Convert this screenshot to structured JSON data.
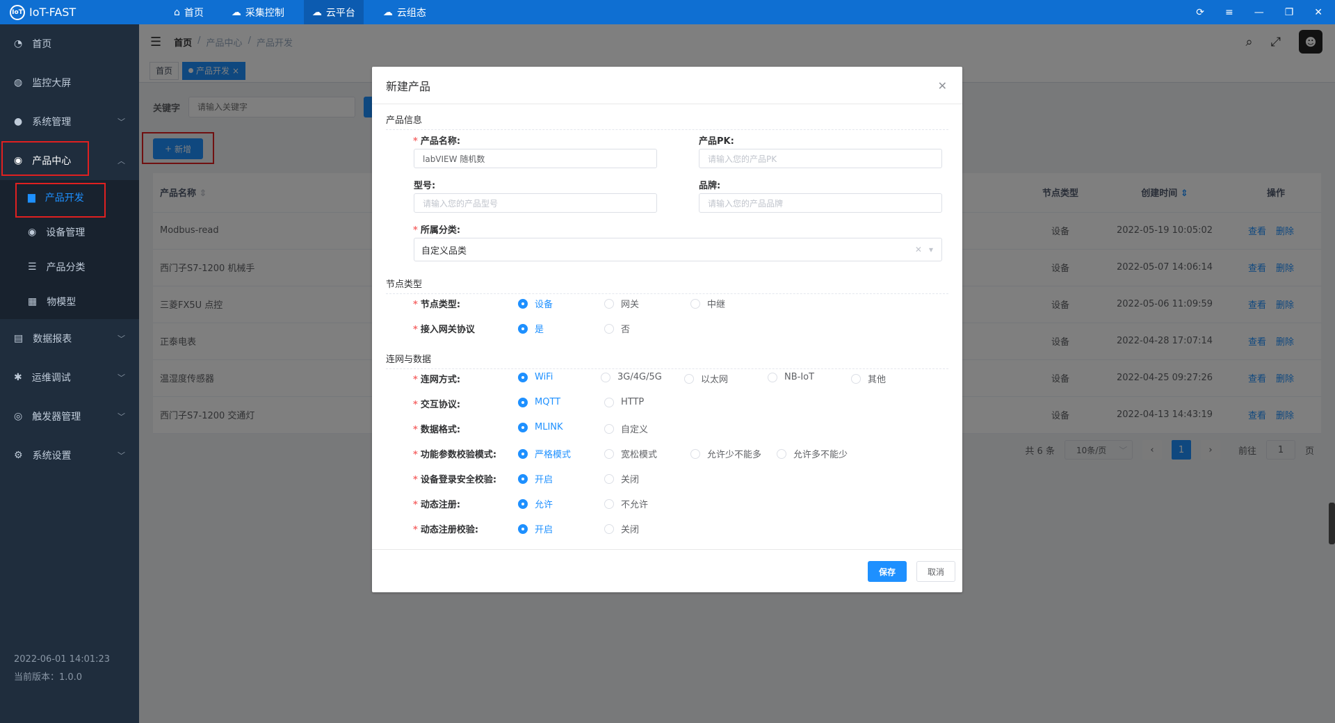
{
  "app": {
    "title": "IoT-FAST",
    "logo_text": "IoT"
  },
  "topnav": [
    {
      "label": "首页",
      "icon": "home-icon"
    },
    {
      "label": "采集控制",
      "icon": "cloud-gear-icon"
    },
    {
      "label": "云平台",
      "icon": "cloud-icon"
    },
    {
      "label": "云组态",
      "icon": "cloud-config-icon"
    }
  ],
  "sidebar": {
    "items": [
      {
        "label": "首页",
        "icon": "dashboard-icon"
      },
      {
        "label": "监控大屏",
        "icon": "globe-icon"
      },
      {
        "label": "系统管理",
        "icon": "user-icon"
      },
      {
        "label": "产品中心",
        "icon": "product-icon"
      },
      {
        "label": "数据报表",
        "icon": "report-icon"
      },
      {
        "label": "运维调试",
        "icon": "debug-icon"
      },
      {
        "label": "触发器管理",
        "icon": "trigger-icon"
      },
      {
        "label": "系统设置",
        "icon": "settings-icon"
      }
    ],
    "subitems": [
      {
        "label": "产品开发"
      },
      {
        "label": "设备管理"
      },
      {
        "label": "产品分类"
      },
      {
        "label": "物模型"
      }
    ],
    "datetime": "2022-06-01 14:01:23",
    "version": "当前版本：1.0.0"
  },
  "breadcrumb": [
    "首页",
    "产品中心",
    "产品开发"
  ],
  "tags": [
    {
      "label": "首页"
    },
    {
      "label": "产品开发"
    }
  ],
  "search": {
    "label": "关键字",
    "placeholder": "请输入关键字"
  },
  "add_button": "新增",
  "table": {
    "headers": {
      "name": "产品名称",
      "node": "节点类型",
      "created": "创建时间",
      "ops": "操作"
    },
    "rows": [
      {
        "name": "Modbus-read",
        "node": "设备",
        "created": "2022-05-19 10:05:02"
      },
      {
        "name": "西门子S7-1200 机械手",
        "node": "设备",
        "created": "2022-05-07 14:06:14"
      },
      {
        "name": "三菱FX5U 点控",
        "node": "设备",
        "created": "2022-05-06 11:09:59"
      },
      {
        "name": "正泰电表",
        "node": "设备",
        "created": "2022-04-28 17:07:14"
      },
      {
        "name": "温湿度传感器",
        "node": "设备",
        "created": "2022-04-25 09:27:26"
      },
      {
        "name": "西门子S7-1200 交通灯",
        "node": "设备",
        "created": "2022-04-13 14:43:19"
      }
    ],
    "view_label": "查看",
    "delete_label": "删除"
  },
  "pager": {
    "total": "共 6 条",
    "size": "10条/页",
    "current": "1",
    "goto": "前往",
    "goto_value": "1",
    "page_suffix": "页"
  },
  "modal": {
    "title": "新建产品",
    "sec_info": "产品信息",
    "name_label": "产品名称:",
    "name_value": "labVIEW 随机数",
    "pk_label": "产品PK:",
    "pk_placeholder": "请输入您的产品PK",
    "model_label": "型号:",
    "model_placeholder": "请输入您的产品型号",
    "brand_label": "品牌:",
    "brand_placeholder": "请输入您的产品品牌",
    "category_label": "所属分类:",
    "category_value": "自定义品类",
    "sec_node": "节点类型",
    "node_type_label": "节点类型:",
    "node_type_options": [
      "设备",
      "网关",
      "中继"
    ],
    "gateway_label": "接入网关协议",
    "gateway_options": [
      "是",
      "否"
    ],
    "sec_net": "连网与数据",
    "net_label": "连网方式:",
    "net_options": [
      "WiFi",
      "3G/4G/5G",
      "以太网",
      "NB-IoT",
      "其他"
    ],
    "proto_label": "交互协议:",
    "proto_options": [
      "MQTT",
      "HTTP"
    ],
    "format_label": "数据格式:",
    "format_options": [
      "MLINK",
      "自定义"
    ],
    "check_label": "功能参数校验模式:",
    "check_options": [
      "严格模式",
      "宽松模式",
      "允许少不能多",
      "允许多不能少"
    ],
    "login_label": "设备登录安全校验:",
    "login_options": [
      "开启",
      "关闭"
    ],
    "dyn_label": "动态注册:",
    "dyn_options": [
      "允许",
      "不允许"
    ],
    "dyncheck_label": "动态注册校验:",
    "dyncheck_options": [
      "开启",
      "关闭"
    ],
    "save": "保存",
    "cancel": "取消"
  }
}
